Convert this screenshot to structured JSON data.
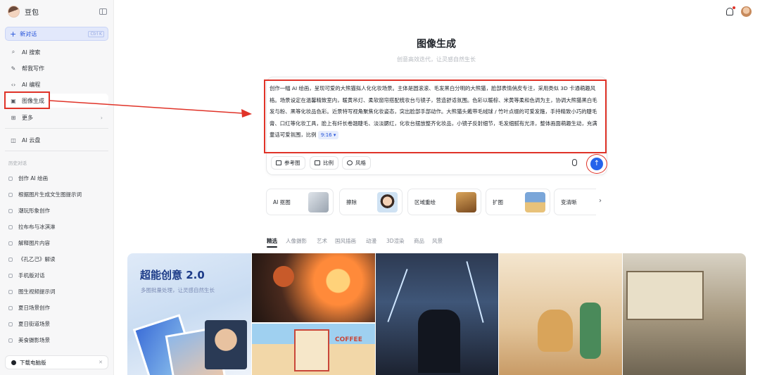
{
  "sidebar": {
    "brand": "豆包",
    "new_chat": {
      "label": "新对话",
      "shortcut": "Ctrl K"
    },
    "nav": [
      {
        "label": "AI 搜索",
        "icon": "search-spark-icon"
      },
      {
        "label": "帮我写作",
        "icon": "pen-icon"
      },
      {
        "label": "AI 编程",
        "icon": "code-icon"
      },
      {
        "label": "图像生成",
        "icon": "image-icon"
      },
      {
        "label": "更多",
        "icon": "grid-icon"
      },
      {
        "label": "AI 云盘",
        "icon": "cloud-drive-icon"
      }
    ],
    "history_label": "历史对话",
    "history": [
      "创作 AI 绘画",
      "根据图片生成文生图提示词",
      "潮玩形象创作",
      "拉布布与冰淇淋",
      "解释图片内容",
      "《孔乙己》解读",
      "手机版对话",
      "图生视频提示词",
      "夏日场景创作",
      "夏日街道场景",
      "美食摄影场景"
    ],
    "download": "下载电脑版"
  },
  "main": {
    "title": "图像生成",
    "subtitle": "创意高效迭代，让灵感自然生长",
    "prompt": "创作一幅 AI 绘画，呈现可爱的大熊猫拟人化化妆场景。主体是圆滚滚、毛发黑白分明的大熊猫，脸部表情俏皮专注，采用类似 3D 卡通萌趣风格。场景设定在温馨精致室内，暖黄吊灯、柔软窗帘搭配梳妆台与镜子，营造舒适氛围。色彩以暖棕、米黄等柔和色调为主，协调大熊猫黑白毛发与粉、黑等化妆品色彩。近景特写视角聚焦化妆姿态，突出脸部手部动作。大熊猫头戴带毛绒球 / 竹叶点缀的可爱发箍，手持精致小巧的睫毛膏、口红等化妆工具，脸上有纤长卷翘睫毛、淡淡腮红，化妆台摆放整齐化妆品，小镜子反射细节，毛发细腻有光泽，整体画面萌趣生动，充满童话可爱氛围，比例",
    "ratio": "9:16",
    "tools": [
      "参考图",
      "比例",
      "风格"
    ],
    "cards": [
      "AI 抠图",
      "擦除",
      "区域重绘",
      "扩图",
      "变清晰"
    ],
    "tabs": [
      "精选",
      "人像摄影",
      "艺术",
      "国风插画",
      "动漫",
      "3D渲染",
      "商品",
      "风景"
    ],
    "promo": {
      "title": "超能创意 2.0",
      "subtitle": "多图批量处理，让灵感自然生长"
    },
    "gallery_text": "COFFEE"
  },
  "colors": {
    "accent": "#2563eb",
    "annotation": "#e03328"
  }
}
